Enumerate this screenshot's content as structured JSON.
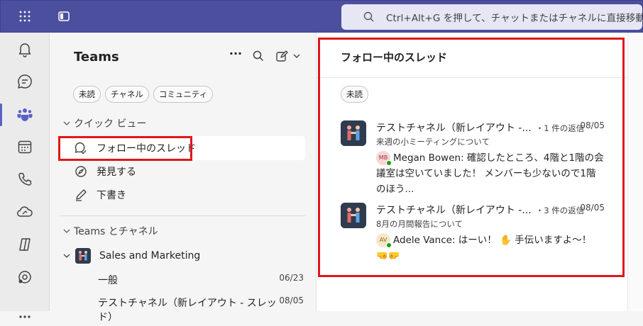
{
  "topbar": {
    "search_placeholder": "Ctrl+Alt+G を押して、チャットまたはチャネルに直接移動する"
  },
  "left_pane": {
    "title": "Teams",
    "filters": [
      "未読",
      "チャネル",
      "コミュニティ"
    ],
    "quick_view_label": "クイック ビュー",
    "quick_items": [
      {
        "label": "フォロー中のスレッド",
        "icon": "followed-threads-icon"
      },
      {
        "label": "発見する",
        "icon": "discover-icon"
      },
      {
        "label": "下書き",
        "icon": "drafts-icon"
      }
    ],
    "teams_section_label": "Teams とチャネル",
    "team": {
      "name": "Sales and Marketing"
    },
    "channels": [
      {
        "name": "一般",
        "date": "06/23"
      },
      {
        "name": "テストチャネル（新レイアウト - スレッド）",
        "date": "08/05"
      }
    ]
  },
  "right_pane": {
    "title": "フォロー中のスレッド",
    "filter": "未読",
    "threads": [
      {
        "name": "テストチャネル（新レイアウト -...",
        "replies": "・1 件の返信",
        "date": "08/05",
        "subject": "来週の小ミーティングについて",
        "author_initials": "MB",
        "author_color": "#f6d6d6",
        "body": "Megan Bowen: 確認したところ、4階と1階の会議室は空いていました！ メンバーも少ないので1階のほう..."
      },
      {
        "name": "テストチャネル（新レイアウト -...",
        "replies": "・3 件の返信",
        "date": "08/05",
        "subject": "8月の月間報告について",
        "author_initials": "AV",
        "author_color": "#f6e7c8",
        "body": "Adele Vance: はーい！ ✋ 手伝いますよ～！ 🤜🤛"
      }
    ]
  },
  "colors": {
    "topbar": "#4c4f9e",
    "accent": "#5b5fc7",
    "highlight": "#e0161b"
  }
}
